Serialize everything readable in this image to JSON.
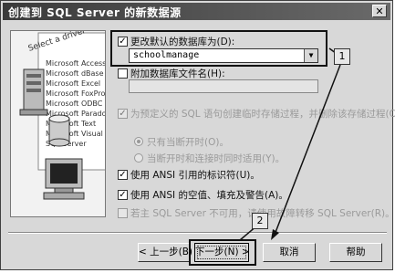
{
  "window": {
    "title": "创建到 SQL Server 的新数据源",
    "close_label": "✕"
  },
  "illustration": {
    "header_text": "Select a driver",
    "driver_items": [
      "Microsoft Access I",
      "Microsoft dBase",
      "Microsoft Excel",
      "Microsoft FoxPro",
      "Microsoft ODBC",
      "Microsoft Paradox",
      "Microsoft Text",
      "Microsoft Visual",
      "SQL Server"
    ]
  },
  "options": {
    "change_default_db": {
      "label": "更改默认的数据库为(D):",
      "checked": true,
      "check_mark": "✓",
      "value": "schoolmanage",
      "arrow": "▼"
    },
    "attach_db_file": {
      "label": "附加数据库文件名(H):",
      "checked": false,
      "value": ""
    },
    "create_temp_sp": {
      "label": "为预定义的 SQL 语句创建临时存储过程，并删除该存储过程(C):",
      "checked": true,
      "check_mark": "✓",
      "enabled": false
    },
    "radio_on_disconnect": {
      "label": "只有当断开时(O)。",
      "selected": true
    },
    "radio_on_disconnect_and": {
      "label": "当断开时和连接时同时适用(Y)。",
      "selected": false
    },
    "ansi_quoted": {
      "label": "使用 ANSI 引用的标识符(U)。",
      "checked": true,
      "check_mark": "✓"
    },
    "ansi_nulls": {
      "label": "使用 ANSI 的空值、填充及警告(A)。",
      "checked": true,
      "check_mark": "✓"
    },
    "failover": {
      "label": "若主 SQL Server 不可用，请使用故障转移 SQL Server(R)。",
      "checked": false,
      "enabled": false
    }
  },
  "buttons": {
    "back": "< 上一步(B)",
    "next": "下一步(N) >",
    "cancel": "取消",
    "help": "帮助"
  },
  "callouts": {
    "one": "1",
    "two": "2"
  }
}
